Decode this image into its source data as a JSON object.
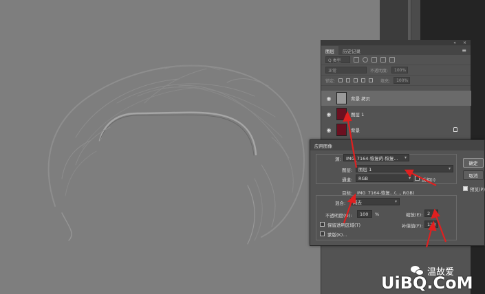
{
  "layers_panel": {
    "tabs": [
      "图层",
      "历史记录"
    ],
    "filter_kind": "Q 类型",
    "blend_mode": "正常",
    "opacity_label": "不透明度:",
    "opacity_value": "100%",
    "lock_label": "锁定:",
    "fill_label": "填充:",
    "fill_value": "100%",
    "layers": [
      {
        "name": "背景 拷贝",
        "thumb_color": "#9a9a9a",
        "selected": true
      },
      {
        "name": "图层 1",
        "thumb_color": "#6b1020",
        "selected": false
      },
      {
        "name": "背景",
        "thumb_color": "#6b1020",
        "selected": false
      }
    ]
  },
  "apply_image": {
    "title": "应用图像",
    "source_label": "源:",
    "source_value": "IMG_7164-恢复的-恢复...",
    "layer_label": "图层:",
    "layer_value": "图层 1",
    "channel_label": "通道:",
    "channel_value": "RGB",
    "invert_label": "反相(I)",
    "target_label": "目标:",
    "target_value": "IMG_7164-恢复...(..., RGB)",
    "blending_label": "混合:",
    "blending_value": "减去",
    "opacity_label": "不透明度(O):",
    "opacity_value": "100",
    "opacity_unit": "%",
    "scale_label": "缩放(E):",
    "scale_value": "2",
    "offset_label": "补偿值(F):",
    "offset_value": "128",
    "preserve_transparency_label": "保留透明区域(T)",
    "mask_label": "蒙版(K)...",
    "ok_label": "确定",
    "cancel_label": "取消",
    "preview_label": "预览(P)"
  },
  "watermark": {
    "author": "温故爱",
    "site": "UiBQ.CoM"
  },
  "colors": {
    "canvas": "#7e7e7e",
    "panel": "#535353",
    "arrow": "#e02020"
  }
}
